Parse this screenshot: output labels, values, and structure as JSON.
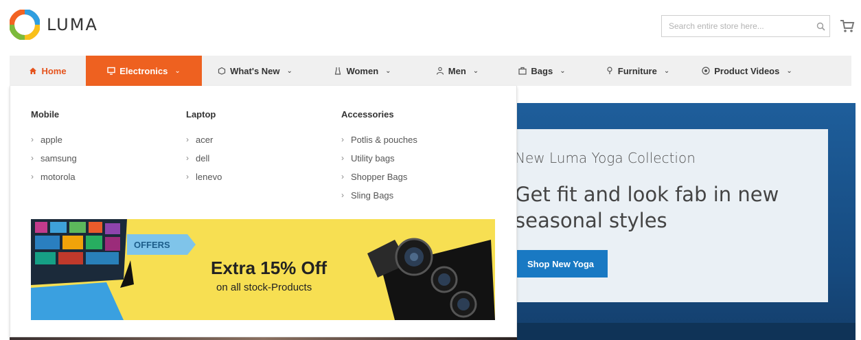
{
  "brand": {
    "name": "LUMA"
  },
  "search": {
    "placeholder": "Search entire store here..."
  },
  "nav": {
    "items": [
      {
        "label": "Home",
        "icon": "home-icon"
      },
      {
        "label": "Electronics",
        "icon": "monitor-icon"
      },
      {
        "label": "What's New",
        "icon": "box-icon"
      },
      {
        "label": "Women",
        "icon": "dress-icon"
      },
      {
        "label": "Men",
        "icon": "person-icon"
      },
      {
        "label": "Bags",
        "icon": "bag-icon"
      },
      {
        "label": "Furniture",
        "icon": "lamp-icon"
      },
      {
        "label": "Product Videos",
        "icon": "play-icon"
      }
    ]
  },
  "menu": {
    "columns": [
      {
        "heading": "Mobile",
        "items": [
          "apple",
          "samsung",
          "motorola"
        ]
      },
      {
        "heading": "Laptop",
        "items": [
          "acer",
          "dell",
          "lenevo"
        ]
      },
      {
        "heading": "Accessories",
        "items": [
          "Potlis & pouches",
          "Utility bags",
          "Shopper Bags",
          "Sling Bags"
        ]
      }
    ]
  },
  "promo": {
    "badge": "OFFERS",
    "title": "Extra 15% Off",
    "subtitle": "on all stock-Products"
  },
  "hero": {
    "subtitle": "New Luma Yoga Collection",
    "title": "Get fit and look fab in new seasonal styles",
    "button": "Shop New Yoga"
  },
  "colors": {
    "accent": "#ee6120",
    "home": "#e5531d",
    "hero_button": "#1979c3",
    "promo_bg": "#f7df52"
  }
}
